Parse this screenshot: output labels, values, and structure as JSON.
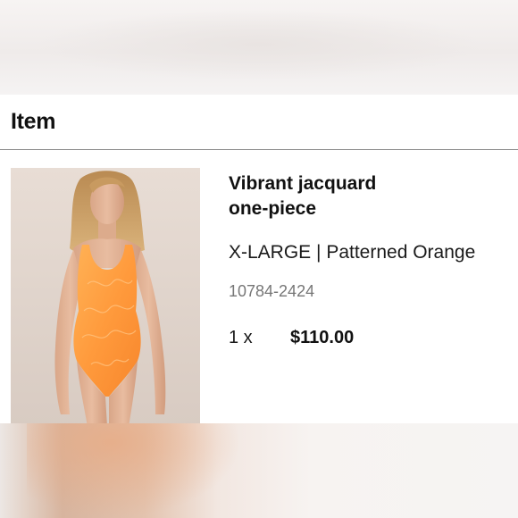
{
  "header": {
    "title": "Item"
  },
  "item": {
    "name_line1": "Vibrant jacquard",
    "name_line2": "one-piece",
    "variant": "X-LARGE | Patterned Orange",
    "sku": "10784-2424",
    "quantity": "1 x",
    "price": "$110.00",
    "image_icon": "product-photo-swimsuit-model",
    "swimsuit_color": "#ff9a3c"
  }
}
